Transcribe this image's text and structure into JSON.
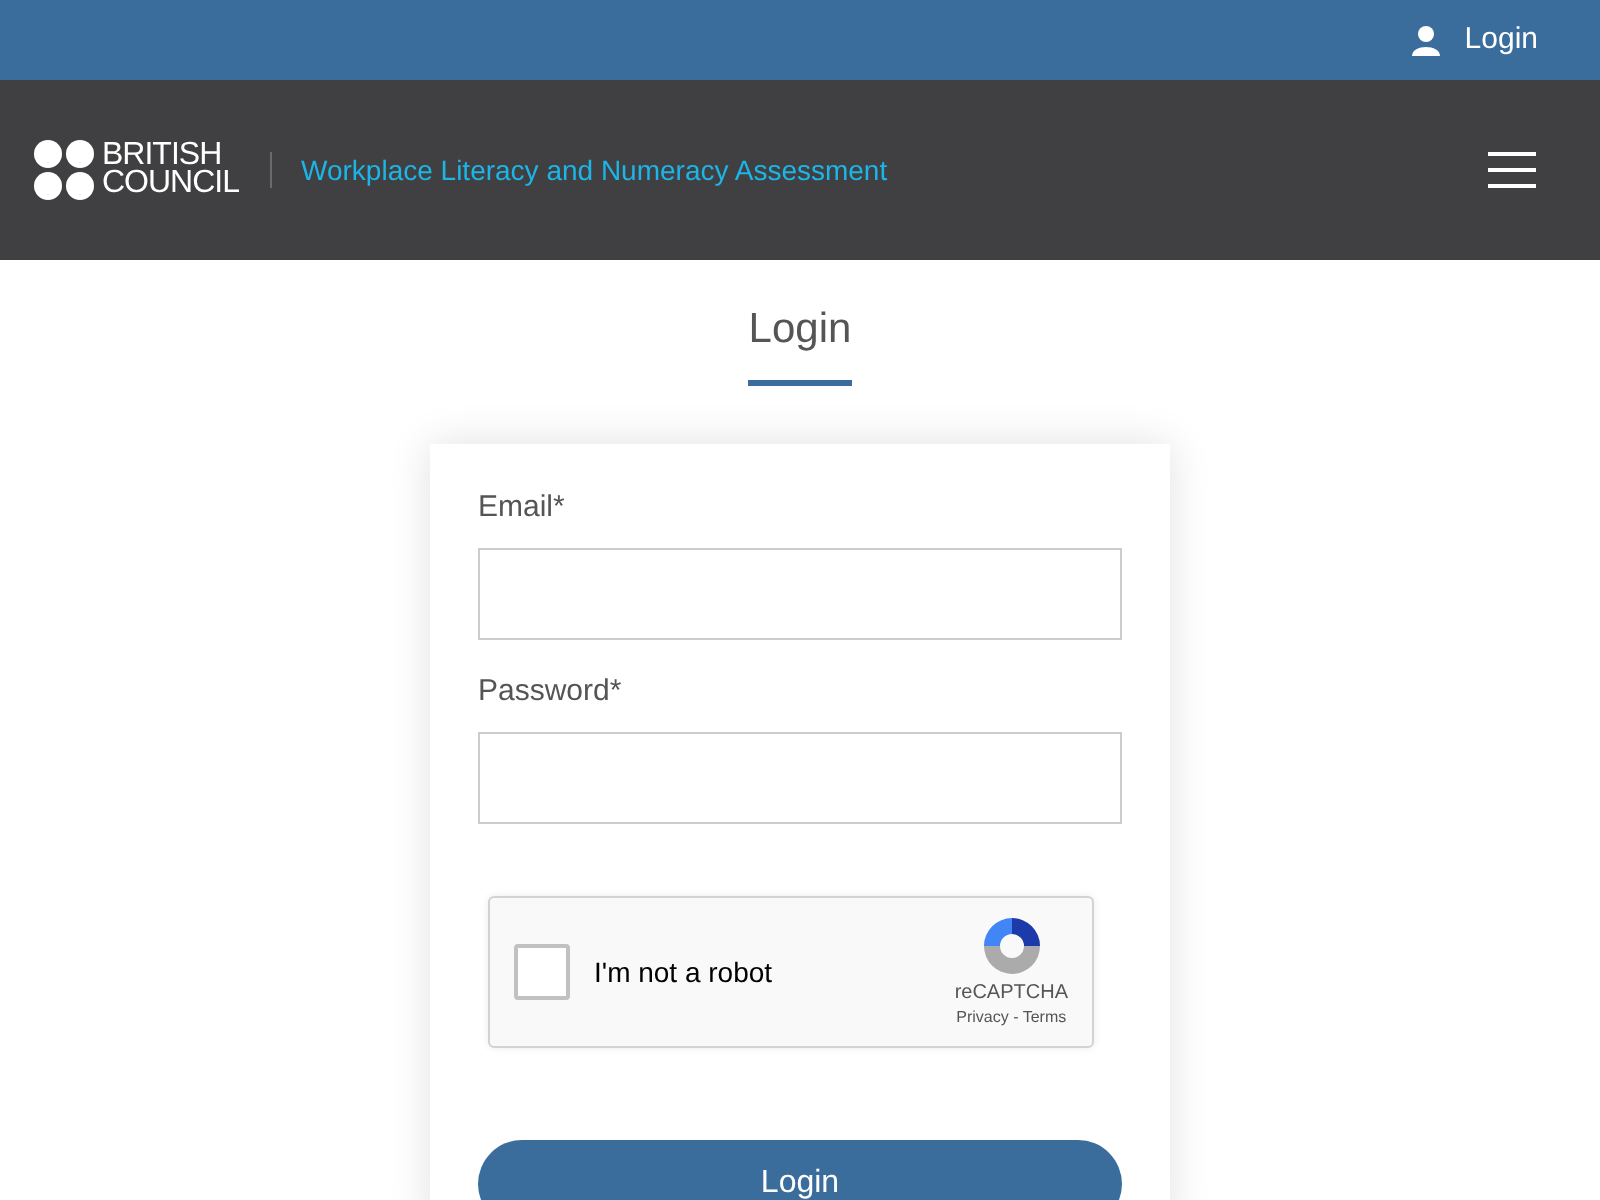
{
  "top_bar": {
    "login_link": "Login"
  },
  "header": {
    "logo_lines": [
      "BRITISH",
      "COUNCIL"
    ],
    "app_title": "Workplace Literacy and Numeracy Assessment"
  },
  "page_title": "Login",
  "form": {
    "fields": [
      {
        "label": "Email*"
      },
      {
        "label": "Password*"
      }
    ],
    "captcha": {
      "label": "I'm not a robot",
      "checked": false,
      "brand": "reCAPTCHA",
      "privacy": "Privacy",
      "separator": " - ",
      "terms": "Terms"
    },
    "submit": "Login"
  }
}
